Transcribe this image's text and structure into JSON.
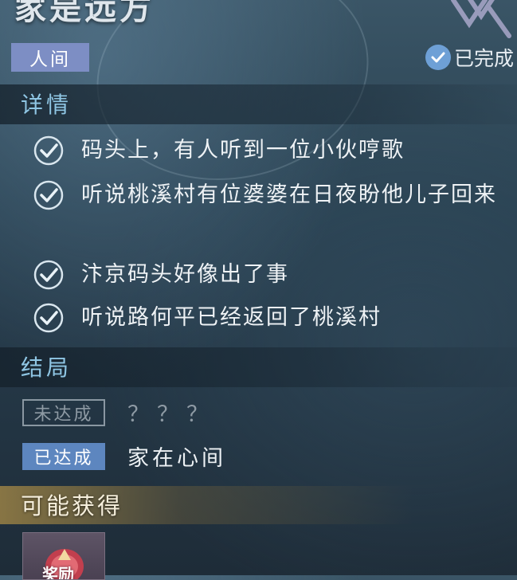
{
  "quest": {
    "title": "家是远方",
    "category_tag": "人间",
    "status": "已完成"
  },
  "details": {
    "heading": "详情",
    "clues": [
      {
        "text": "码头上，有人听到一位小伙哼歌",
        "checked": true
      },
      {
        "text": "听说桃溪村有位婆婆在日夜盼他儿子回来",
        "checked": true
      },
      {
        "text": "汴京码头好像出了事",
        "checked": true
      },
      {
        "text": "听说路何平已经返回了桃溪村",
        "checked": true
      }
    ]
  },
  "endings": {
    "heading": "结局",
    "rows": [
      {
        "state": "未达成",
        "text": "？？？"
      },
      {
        "state": "已达成",
        "text": "家在心间"
      }
    ]
  },
  "rewards": {
    "heading": "可能获得",
    "items": [
      {
        "label": "奖励",
        "icon": "reward-token-icon"
      }
    ]
  },
  "colors": {
    "tag_bg": "#7d8ec4",
    "section_title": "#8fc6e4",
    "met_badge": "#5d86bf",
    "check_badge": "#6ea0d6"
  }
}
